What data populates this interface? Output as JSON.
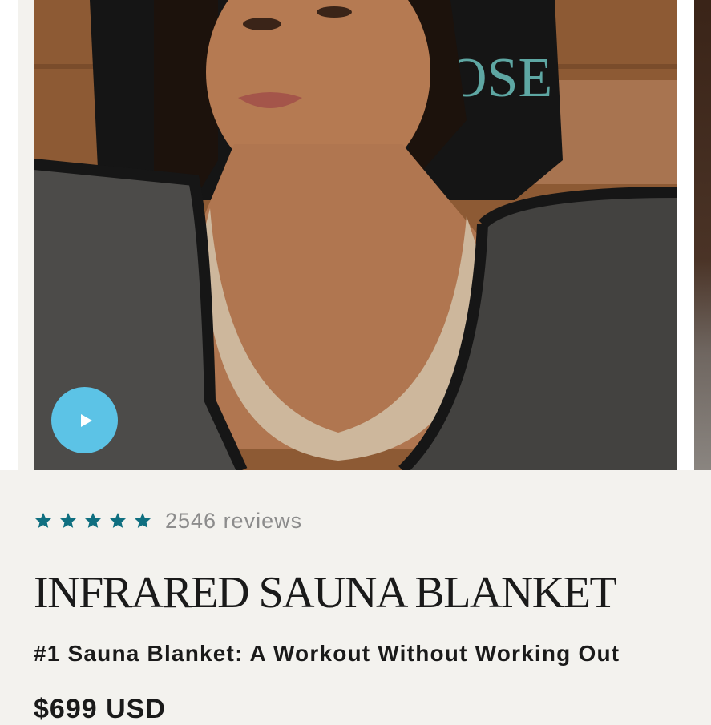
{
  "gallery": {
    "hero_alt": "Woman lying in infrared sauna blanket",
    "towel_text": "OSE",
    "play_icon": "play-icon",
    "play_button_color": "#5cc3e6"
  },
  "rating": {
    "stars": 5,
    "star_icon": "star-icon",
    "star_color": "#0f6f80",
    "reviews_label": "2546 reviews"
  },
  "product": {
    "title": "INFRARED SAUNA BLANKET",
    "subtitle": "#1 Sauna Blanket: A Workout Without Working Out",
    "price": "$699 USD"
  }
}
